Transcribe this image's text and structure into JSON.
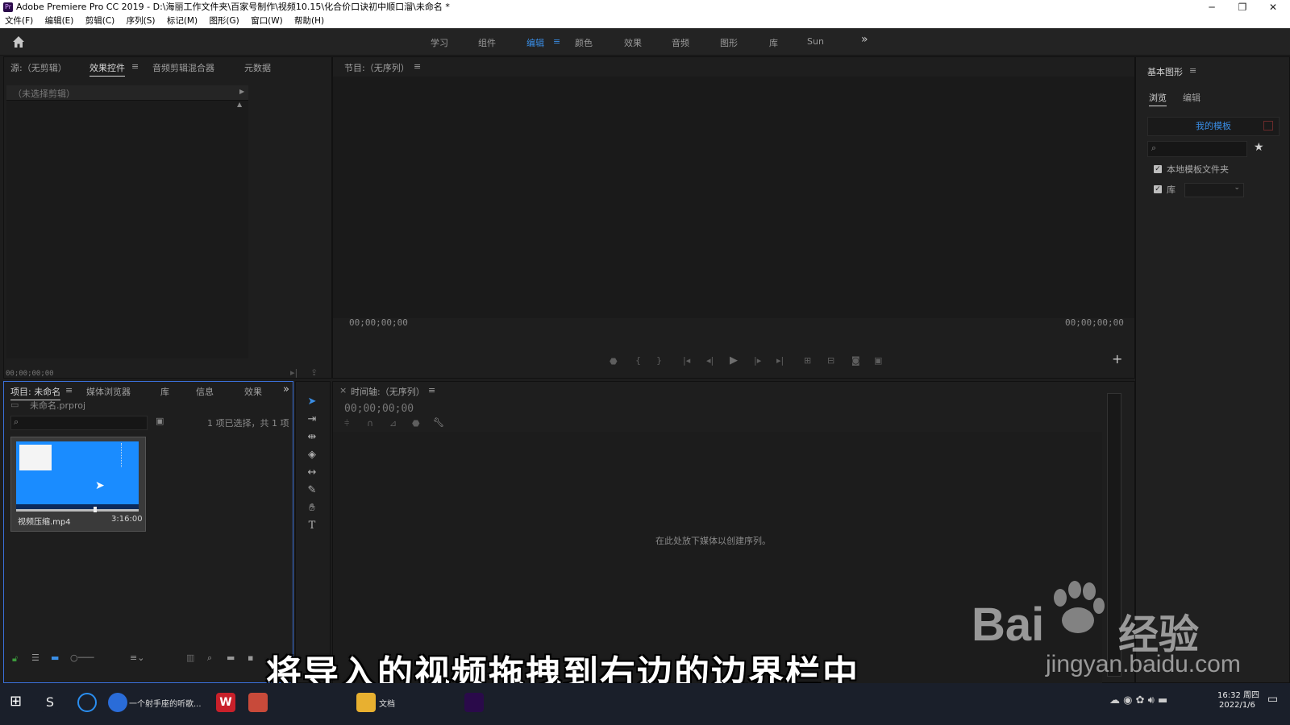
{
  "titlebar": {
    "app_icon": "Pr",
    "title": "Adobe Premiere Pro CC 2019 - D:\\海丽工作文件夹\\百家号制作\\视频10.15\\化合价口诀初中顺口溜\\未命名 *",
    "minimize": "─",
    "restore": "❐",
    "close": "✕"
  },
  "menu": [
    "文件(F)",
    "编辑(E)",
    "剪辑(C)",
    "序列(S)",
    "标记(M)",
    "图形(G)",
    "窗口(W)",
    "帮助(H)"
  ],
  "workspaces": {
    "tabs": [
      "学习",
      "组件",
      "编辑",
      "颜色",
      "效果",
      "音频",
      "图形",
      "库",
      "Sun"
    ],
    "active": "编辑",
    "more": "»"
  },
  "source_panel": {
    "tabs": [
      "源:（无剪辑）",
      "效果控件",
      "音频剪辑混合器",
      "元数据"
    ],
    "active_tab": "效果控件",
    "no_clip": "（未选择剪辑）",
    "timecode": "00;00;00;00"
  },
  "program_panel": {
    "title": "节目:（无序列）",
    "timecode_left": "00;00;00;00",
    "timecode_right": "00;00;00;00",
    "add_button": "+"
  },
  "essential_graphics": {
    "title": "基本图形",
    "tabs": [
      "浏览",
      "编辑"
    ],
    "my_templates": "我的模板",
    "local_templates": "本地模板文件夹",
    "library": "库"
  },
  "project_panel": {
    "tabs": [
      "项目: 未命名",
      "媒体浏览器",
      "库",
      "信息",
      "效果"
    ],
    "project_file": "未命名.prproj",
    "selection_info": "1 项已选择，共 1 项",
    "clip": {
      "name": "视频压缩.mp4",
      "duration": "3:16:00"
    }
  },
  "timeline_panel": {
    "title": "时间轴:（无序列）",
    "timecode": "00;00;00;00",
    "drop_hint": "在此处放下媒体以创建序列。"
  },
  "caption": "将导入的视频拖拽到右边的边界栏中",
  "watermark": {
    "brand": "Bai",
    "brand2": "经验",
    "url": "jingyan.baidu.com"
  },
  "taskbar": {
    "item1": "一个射手座的听歌...",
    "item2": "文档",
    "time": "16:32 周四",
    "date": "2022/1/6"
  },
  "colors": {
    "accent": "#3a8ee6",
    "panel_bg": "#1e1e1e",
    "thumb_blue": "#1a8cff"
  }
}
